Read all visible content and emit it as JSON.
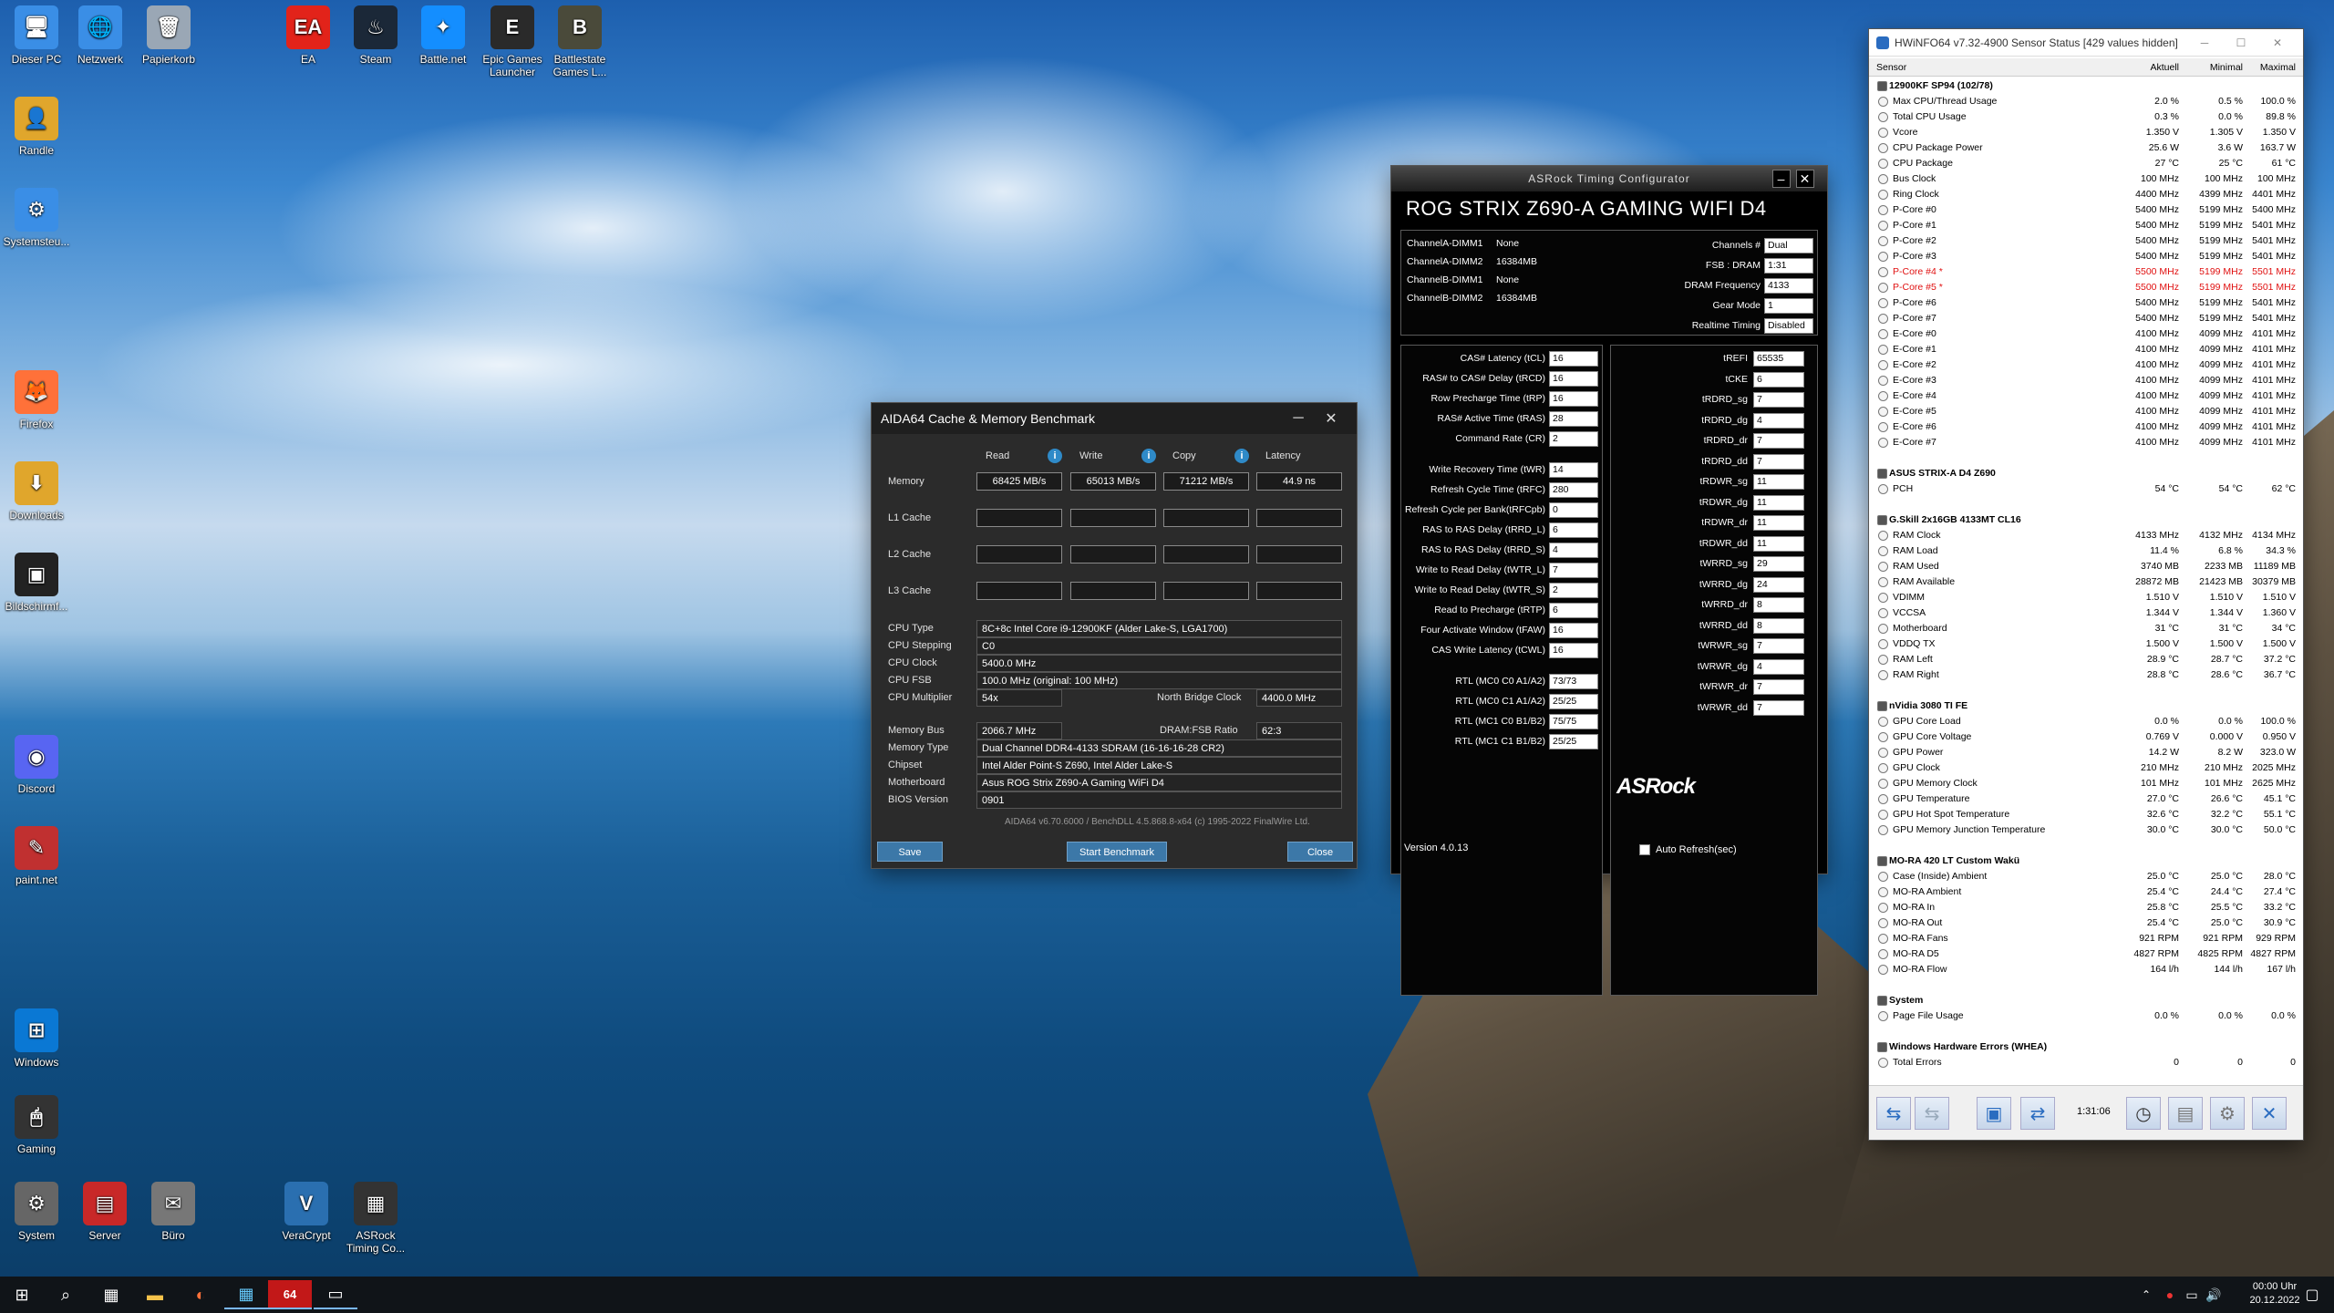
{
  "desktop": {
    "icons": [
      {
        "label": "Dieser PC",
        "icon": "computer-icon",
        "color": "#3a8ee6",
        "glyph": "🖥"
      },
      {
        "label": "Netzwerk",
        "icon": "network-icon",
        "color": "#3a8ee6",
        "glyph": "🌐"
      },
      {
        "label": "Papierkorb",
        "icon": "recycle-bin-icon",
        "color": "#9aa7b5",
        "glyph": "🗑"
      },
      {
        "label": "EA",
        "icon": "ea-icon",
        "color": "#e2231a",
        "glyph": "EA"
      },
      {
        "label": "Steam",
        "icon": "steam-icon",
        "color": "#1b2838",
        "glyph": "♨"
      },
      {
        "label": "Battle.net",
        "icon": "battlenet-icon",
        "color": "#148eff",
        "glyph": "✦"
      },
      {
        "label": "Epic Games Launcher",
        "icon": "epic-games-icon",
        "color": "#2a2a2a",
        "glyph": "E"
      },
      {
        "label": "Battlestate Games L...",
        "icon": "battlestate-icon",
        "color": "#4a4a3a",
        "glyph": "B"
      },
      {
        "label": "Randle",
        "icon": "user-folder-icon",
        "color": "#e0a62c",
        "glyph": "👤"
      },
      {
        "label": "Systemsteu...",
        "icon": "control-panel-icon",
        "color": "#3a8ee6",
        "glyph": "⚙"
      },
      {
        "label": "Firefox",
        "icon": "firefox-icon",
        "color": "#ff7139",
        "glyph": "🦊"
      },
      {
        "label": "Downloads",
        "icon": "downloads-icon",
        "color": "#e0a62c",
        "glyph": "⬇"
      },
      {
        "label": "Bildschirmf...",
        "icon": "screenshot-icon",
        "color": "#222",
        "glyph": "▣"
      },
      {
        "label": "Discord",
        "icon": "discord-icon",
        "color": "#5865f2",
        "glyph": "◉"
      },
      {
        "label": "paint.net",
        "icon": "paintnet-icon",
        "color": "#c03030",
        "glyph": "✎"
      },
      {
        "label": "Windows",
        "icon": "windows-icon",
        "color": "#0a78d4",
        "glyph": "⊞"
      },
      {
        "label": "Gaming",
        "icon": "gaming-icon",
        "color": "#333",
        "glyph": "🖱"
      },
      {
        "label": "System",
        "icon": "system-icon",
        "color": "#666",
        "glyph": "⚙"
      },
      {
        "label": "Server",
        "icon": "server-icon",
        "color": "#c82828",
        "glyph": "▤"
      },
      {
        "label": "Büro",
        "icon": "office-icon",
        "color": "#777",
        "glyph": "✉"
      },
      {
        "label": "VeraCrypt",
        "icon": "veracrypt-icon",
        "color": "#2a6fb0",
        "glyph": "V"
      },
      {
        "label": "ASRock Timing Co...",
        "icon": "asrock-timing-icon",
        "color": "#333",
        "glyph": "▦"
      }
    ]
  },
  "aida": {
    "title": "AIDA64 Cache & Memory Benchmark",
    "minimize": "─",
    "close": "✕",
    "cols": [
      "Read",
      "Write",
      "Copy",
      "Latency"
    ],
    "rows": [
      {
        "label": "Memory",
        "read": "68425 MB/s",
        "write": "65013 MB/s",
        "copy": "71212 MB/s",
        "lat": "44.9 ns"
      },
      {
        "label": "L1 Cache",
        "read": "",
        "write": "",
        "copy": "",
        "lat": ""
      },
      {
        "label": "L2 Cache",
        "read": "",
        "write": "",
        "copy": "",
        "lat": ""
      },
      {
        "label": "L3 Cache",
        "read": "",
        "write": "",
        "copy": "",
        "lat": ""
      }
    ],
    "info": [
      {
        "label": "CPU Type",
        "value": "8C+8c Intel Core i9-12900KF  (Alder Lake-S, LGA1700)"
      },
      {
        "label": "CPU Stepping",
        "value": "C0"
      },
      {
        "label": "CPU Clock",
        "value": "5400.0 MHz"
      },
      {
        "label": "CPU FSB",
        "value": "100.0 MHz  (original: 100 MHz)"
      }
    ],
    "cpu_multiplier_label": "CPU Multiplier",
    "cpu_multiplier": "54x",
    "nb_clock_label": "North Bridge Clock",
    "nb_clock": "4400.0 MHz",
    "mem_bus_label": "Memory Bus",
    "mem_bus": "2066.7 MHz",
    "dram_ratio_label": "DRAM:FSB Ratio",
    "dram_ratio": "62:3",
    "info2": [
      {
        "label": "Memory Type",
        "value": "Dual Channel DDR4-4133 SDRAM  (16-16-16-28 CR2)"
      },
      {
        "label": "Chipset",
        "value": "Intel Alder Point-S Z690, Intel Alder Lake-S"
      },
      {
        "label": "Motherboard",
        "value": "Asus ROG Strix Z690-A Gaming WiFi D4"
      },
      {
        "label": "BIOS Version",
        "value": "0901"
      }
    ],
    "footer": "AIDA64 v6.70.6000 / BenchDLL 4.5.868.8-x64  (c) 1995-2022 FinalWire Ltd.",
    "save": "Save",
    "start": "Start Benchmark",
    "close_btn": "Close"
  },
  "asrock": {
    "title": "ASRock Timing Configurator",
    "board": "ROG STRIX Z690-A GAMING WIFI D4",
    "dimms": [
      {
        "label": "ChannelA-DIMM1",
        "value": "None"
      },
      {
        "label": "ChannelA-DIMM2",
        "value": "16384MB"
      },
      {
        "label": "ChannelB-DIMM1",
        "value": "None"
      },
      {
        "label": "ChannelB-DIMM2",
        "value": "16384MB"
      }
    ],
    "top_right": [
      {
        "label": "Channels #",
        "value": "Dual"
      },
      {
        "label": "FSB : DRAM",
        "value": "1:31"
      },
      {
        "label": "DRAM Frequency",
        "value": "4133"
      },
      {
        "label": "Gear Mode",
        "value": "1"
      },
      {
        "label": "Realtime Timing",
        "value": "Disabled"
      }
    ],
    "primary": [
      {
        "label": "CAS# Latency (tCL)",
        "value": "16"
      },
      {
        "label": "RAS# to CAS# Delay (tRCD)",
        "value": "16"
      },
      {
        "label": "Row Precharge Time (tRP)",
        "value": "16"
      },
      {
        "label": "RAS# Active Time (tRAS)",
        "value": "28"
      },
      {
        "label": "Command Rate (CR)",
        "value": "2"
      }
    ],
    "secondary": [
      {
        "label": "Write Recovery Time (tWR)",
        "value": "14"
      },
      {
        "label": "Refresh Cycle Time (tRFC)",
        "value": "280"
      },
      {
        "label": "Refresh Cycle per Bank(tRFCpb)",
        "value": "0"
      },
      {
        "label": "RAS to RAS Delay (tRRD_L)",
        "value": "6"
      },
      {
        "label": "RAS to RAS Delay (tRRD_S)",
        "value": "4"
      },
      {
        "label": "Write to Read Delay (tWTR_L)",
        "value": "7"
      },
      {
        "label": "Write to Read Delay (tWTR_S)",
        "value": "2"
      },
      {
        "label": "Read to Precharge (tRTP)",
        "value": "6"
      },
      {
        "label": "Four Activate Window (tFAW)",
        "value": "16"
      },
      {
        "label": "CAS Write Latency (tCWL)",
        "value": "16"
      }
    ],
    "rtl": [
      {
        "label": "RTL (MC0 C0 A1/A2)",
        "value": "73/73"
      },
      {
        "label": "RTL (MC0 C1 A1/A2)",
        "value": "25/25"
      },
      {
        "label": "RTL (MC1 C0 B1/B2)",
        "value": "75/75"
      },
      {
        "label": "RTL (MC1 C1 B1/B2)",
        "value": "25/25"
      }
    ],
    "right": [
      {
        "label": "tREFI",
        "value": "65535"
      },
      {
        "label": "tCKE",
        "value": "6"
      },
      {
        "label": "tRDRD_sg",
        "value": "7"
      },
      {
        "label": "tRDRD_dg",
        "value": "4"
      },
      {
        "label": "tRDRD_dr",
        "value": "7"
      },
      {
        "label": "tRDRD_dd",
        "value": "7"
      },
      {
        "label": "tRDWR_sg",
        "value": "11"
      },
      {
        "label": "tRDWR_dg",
        "value": "11"
      },
      {
        "label": "tRDWR_dr",
        "value": "11"
      },
      {
        "label": "tRDWR_dd",
        "value": "11"
      },
      {
        "label": "tWRRD_sg",
        "value": "29"
      },
      {
        "label": "tWRRD_dg",
        "value": "24"
      },
      {
        "label": "tWRRD_dr",
        "value": "8"
      },
      {
        "label": "tWRRD_dd",
        "value": "8"
      },
      {
        "label": "tWRWR_sg",
        "value": "7"
      },
      {
        "label": "tWRWR_dg",
        "value": "4"
      },
      {
        "label": "tWRWR_dr",
        "value": "7"
      },
      {
        "label": "tWRWR_dd",
        "value": "7"
      }
    ],
    "logo": "ASRock",
    "version": "Version 4.0.13",
    "auto_refresh": "Auto Refresh(sec)"
  },
  "hwinfo": {
    "title": "HWiNFO64 v7.32-4900 Sensor Status [429 values hidden]",
    "cols": [
      "Sensor",
      "Aktuell",
      "Minimal",
      "Maximal"
    ],
    "rows": [
      {
        "t": "g",
        "n": "12900KF SP94 (102/78)"
      },
      {
        "n": "Max CPU/Thread Usage",
        "a": "2.0 %",
        "b": "0.5 %",
        "c": "100.0 %"
      },
      {
        "n": "Total CPU Usage",
        "a": "0.3 %",
        "b": "0.0 %",
        "c": "89.8 %"
      },
      {
        "n": "Vcore",
        "a": "1.350 V",
        "b": "1.305 V",
        "c": "1.350 V"
      },
      {
        "n": "CPU Package Power",
        "a": "25.6 W",
        "b": "3.6 W",
        "c": "163.7 W"
      },
      {
        "n": "CPU Package",
        "a": "27 °C",
        "b": "25 °C",
        "c": "61 °C"
      },
      {
        "n": "Bus Clock",
        "a": "100 MHz",
        "b": "100 MHz",
        "c": "100 MHz"
      },
      {
        "n": "Ring Clock",
        "a": "4400 MHz",
        "b": "4399 MHz",
        "c": "4401 MHz"
      },
      {
        "n": "P-Core #0",
        "a": "5400 MHz",
        "b": "5199 MHz",
        "c": "5400 MHz"
      },
      {
        "n": "P-Core #1",
        "a": "5400 MHz",
        "b": "5199 MHz",
        "c": "5401 MHz"
      },
      {
        "n": "P-Core #2",
        "a": "5400 MHz",
        "b": "5199 MHz",
        "c": "5401 MHz"
      },
      {
        "n": "P-Core #3",
        "a": "5400 MHz",
        "b": "5199 MHz",
        "c": "5401 MHz"
      },
      {
        "t": "r",
        "n": "P-Core #4 *",
        "a": "5500 MHz",
        "b": "5199 MHz",
        "c": "5501 MHz"
      },
      {
        "t": "r",
        "n": "P-Core #5 *",
        "a": "5500 MHz",
        "b": "5199 MHz",
        "c": "5501 MHz"
      },
      {
        "n": "P-Core #6",
        "a": "5400 MHz",
        "b": "5199 MHz",
        "c": "5401 MHz"
      },
      {
        "n": "P-Core #7",
        "a": "5400 MHz",
        "b": "5199 MHz",
        "c": "5401 MHz"
      },
      {
        "n": "E-Core #0",
        "a": "4100 MHz",
        "b": "4099 MHz",
        "c": "4101 MHz"
      },
      {
        "n": "E-Core #1",
        "a": "4100 MHz",
        "b": "4099 MHz",
        "c": "4101 MHz"
      },
      {
        "n": "E-Core #2",
        "a": "4100 MHz",
        "b": "4099 MHz",
        "c": "4101 MHz"
      },
      {
        "n": "E-Core #3",
        "a": "4100 MHz",
        "b": "4099 MHz",
        "c": "4101 MHz"
      },
      {
        "n": "E-Core #4",
        "a": "4100 MHz",
        "b": "4099 MHz",
        "c": "4101 MHz"
      },
      {
        "n": "E-Core #5",
        "a": "4100 MHz",
        "b": "4099 MHz",
        "c": "4101 MHz"
      },
      {
        "n": "E-Core #6",
        "a": "4100 MHz",
        "b": "4099 MHz",
        "c": "4101 MHz"
      },
      {
        "n": "E-Core #7",
        "a": "4100 MHz",
        "b": "4099 MHz",
        "c": "4101 MHz"
      },
      {
        "t": "s"
      },
      {
        "t": "g",
        "n": "ASUS STRIX-A D4 Z690"
      },
      {
        "n": "PCH",
        "a": "54 °C",
        "b": "54 °C",
        "c": "62 °C"
      },
      {
        "t": "s"
      },
      {
        "t": "g",
        "n": "G.Skill 2x16GB 4133MT CL16"
      },
      {
        "n": "RAM Clock",
        "a": "4133 MHz",
        "b": "4132 MHz",
        "c": "4134 MHz"
      },
      {
        "n": "RAM Load",
        "a": "11.4 %",
        "b": "6.8 %",
        "c": "34.3 %"
      },
      {
        "n": "RAM Used",
        "a": "3740 MB",
        "b": "2233 MB",
        "c": "11189 MB"
      },
      {
        "n": "RAM Available",
        "a": "28872 MB",
        "b": "21423 MB",
        "c": "30379 MB"
      },
      {
        "n": "VDIMM",
        "a": "1.510 V",
        "b": "1.510 V",
        "c": "1.510 V"
      },
      {
        "n": "VCCSA",
        "a": "1.344 V",
        "b": "1.344 V",
        "c": "1.360 V"
      },
      {
        "n": "Motherboard",
        "a": "31 °C",
        "b": "31 °C",
        "c": "34 °C"
      },
      {
        "n": "VDDQ TX",
        "a": "1.500 V",
        "b": "1.500 V",
        "c": "1.500 V"
      },
      {
        "n": "RAM Left",
        "a": "28.9 °C",
        "b": "28.7 °C",
        "c": "37.2 °C"
      },
      {
        "n": "RAM Right",
        "a": "28.8 °C",
        "b": "28.6 °C",
        "c": "36.7 °C"
      },
      {
        "t": "s"
      },
      {
        "t": "g",
        "n": "nVidia 3080 TI FE"
      },
      {
        "n": "GPU Core Load",
        "a": "0.0 %",
        "b": "0.0 %",
        "c": "100.0 %"
      },
      {
        "n": "GPU Core Voltage",
        "a": "0.769 V",
        "b": "0.000 V",
        "c": "0.950 V"
      },
      {
        "n": "GPU Power",
        "a": "14.2 W",
        "b": "8.2 W",
        "c": "323.0 W"
      },
      {
        "n": "GPU Clock",
        "a": "210 MHz",
        "b": "210 MHz",
        "c": "2025 MHz"
      },
      {
        "n": "GPU Memory Clock",
        "a": "101 MHz",
        "b": "101 MHz",
        "c": "2625 MHz"
      },
      {
        "n": "GPU Temperature",
        "a": "27.0 °C",
        "b": "26.6 °C",
        "c": "45.1 °C"
      },
      {
        "n": "GPU Hot Spot Temperature",
        "a": "32.6 °C",
        "b": "32.2 °C",
        "c": "55.1 °C"
      },
      {
        "n": "GPU Memory Junction Temperature",
        "a": "30.0 °C",
        "b": "30.0 °C",
        "c": "50.0 °C"
      },
      {
        "t": "s"
      },
      {
        "t": "g",
        "n": "MO-RA 420 LT Custom Wakü"
      },
      {
        "n": "Case (Inside) Ambient",
        "a": "25.0 °C",
        "b": "25.0 °C",
        "c": "28.0 °C"
      },
      {
        "n": "MO-RA Ambient",
        "a": "25.4 °C",
        "b": "24.4 °C",
        "c": "27.4 °C"
      },
      {
        "n": "MO-RA In",
        "a": "25.8 °C",
        "b": "25.5 °C",
        "c": "33.2 °C"
      },
      {
        "n": "MO-RA Out",
        "a": "25.4 °C",
        "b": "25.0 °C",
        "c": "30.9 °C"
      },
      {
        "n": "MO-RA Fans",
        "a": "921 RPM",
        "b": "921 RPM",
        "c": "929 RPM"
      },
      {
        "n": "MO-RA D5",
        "a": "4827 RPM",
        "b": "4825 RPM",
        "c": "4827 RPM"
      },
      {
        "n": "MO-RA Flow",
        "a": "164 l/h",
        "b": "144 l/h",
        "c": "167 l/h"
      },
      {
        "t": "s"
      },
      {
        "t": "g",
        "n": "System"
      },
      {
        "n": "Page File Usage",
        "a": "0.0 %",
        "b": "0.0 %",
        "c": "0.0 %"
      },
      {
        "t": "s"
      },
      {
        "t": "g",
        "n": "Windows Hardware Errors (WHEA)"
      },
      {
        "n": "Total Errors",
        "a": "0",
        "b": "0",
        "c": "0"
      }
    ],
    "elapsed": "1:31:06"
  },
  "taskbar": {
    "time": "00:00 Uhr",
    "date": "20.12.2022",
    "start_icon": "⊞",
    "search_icon": "⌕"
  }
}
